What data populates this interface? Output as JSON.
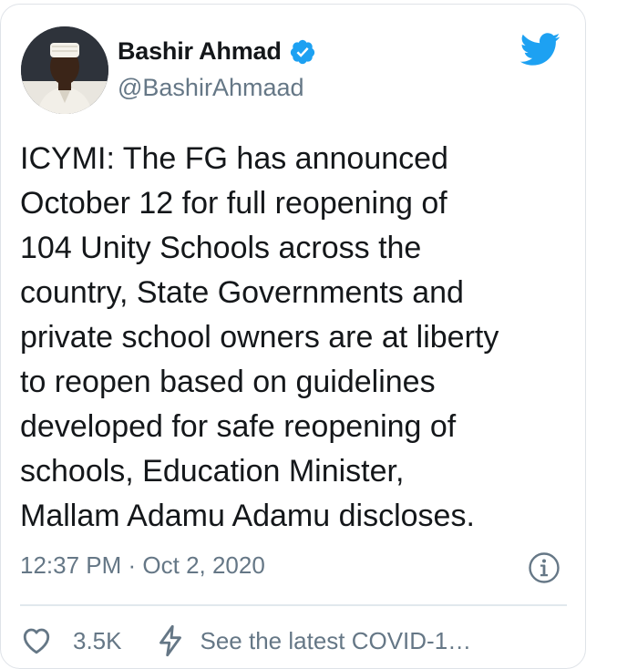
{
  "author": {
    "display_name": "Bashir Ahmad",
    "handle": "@BashirAhmaad",
    "verified": true,
    "avatar_icon": "profile-photo"
  },
  "tweet": {
    "text": "ICYMI: The FG has announced\nOctober 12 for full reopening of\n104 Unity Schools across the\ncountry, State Governments and\nprivate school owners are at liberty\nto reopen based on guidelines\ndeveloped for safe reopening of\nschools, Education Minister,\nMallam Adamu Adamu discloses.",
    "timestamp": "12:37 PM · Oct 2, 2020"
  },
  "actions": {
    "like_count": "3.5K",
    "covid_label": "See the latest COVID-1…"
  },
  "colors": {
    "brand": "#1da1f2",
    "text_primary": "#14171a",
    "text_secondary": "#657786",
    "border": "#e1e8ed"
  },
  "icons": {
    "twitter": "twitter-bird-icon",
    "verified": "verified-badge-icon",
    "info": "info-icon",
    "like": "heart-icon",
    "covid": "lightning-bolt-icon"
  }
}
